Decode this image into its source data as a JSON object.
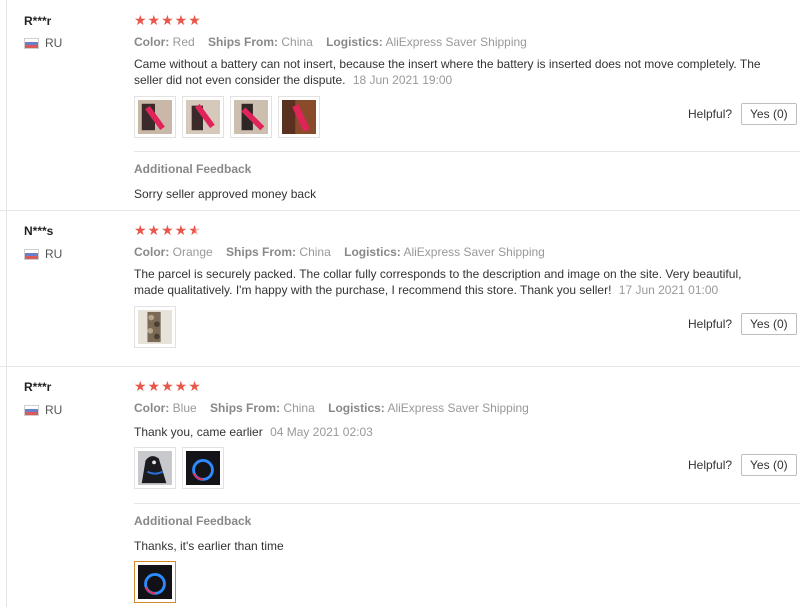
{
  "labels": {
    "color": "Color:",
    "ships_from": "Ships From:",
    "logistics": "Logistics:",
    "helpful": "Helpful?",
    "additional_feedback": "Additional Feedback"
  },
  "reviews": [
    {
      "user": "R***r",
      "country": "RU",
      "rating": 5,
      "stars": "★★★★★",
      "color": "Red",
      "ships_from": "China",
      "logistics": "AliExpress Saver Shipping",
      "text": "Came without a battery can not insert, because the insert where the battery is inserted does not move completely. The seller did not even consider the dispute.",
      "date": "18 Jun 2021 19:00",
      "photos": [
        "collar-red-photo",
        "collar-red-photo",
        "collar-red-photo",
        "collar-red-photo"
      ],
      "helpful_button": "Yes (0)",
      "additional_feedback_text": "Sorry seller approved money back"
    },
    {
      "user": "N***s",
      "country": "RU",
      "rating": 4.5,
      "stars": "★★★★★",
      "color": "Orange",
      "ships_from": "China",
      "logistics": "AliExpress Saver Shipping",
      "text": "The parcel is securely packed. The collar fully corresponds to the description and image on the site. Very beautiful, made qualitatively. I'm happy with the purchase, I recommend this store. Thank you seller!",
      "date": "17 Jun 2021 01:00",
      "photos": [
        "collar-camo-photo"
      ],
      "helpful_button": "Yes (0)"
    },
    {
      "user": "R***r",
      "country": "RU",
      "rating": 5,
      "stars": "★★★★★",
      "color": "Blue",
      "ships_from": "China",
      "logistics": "AliExpress Saver Shipping",
      "text": "Thank you, came earlier",
      "date": "04 May 2021 02:03",
      "photos": [
        "dog-collar-photo",
        "collar-blue-glow-photo"
      ],
      "helpful_button": "Yes (0)",
      "additional_feedback_text": "Thanks, it's earlier than time",
      "additional_photos": [
        "collar-blue-glow-photo"
      ]
    }
  ],
  "colors": {
    "star": "#e9574b",
    "muted": "#999999",
    "selected_border": "#d08a2a"
  }
}
